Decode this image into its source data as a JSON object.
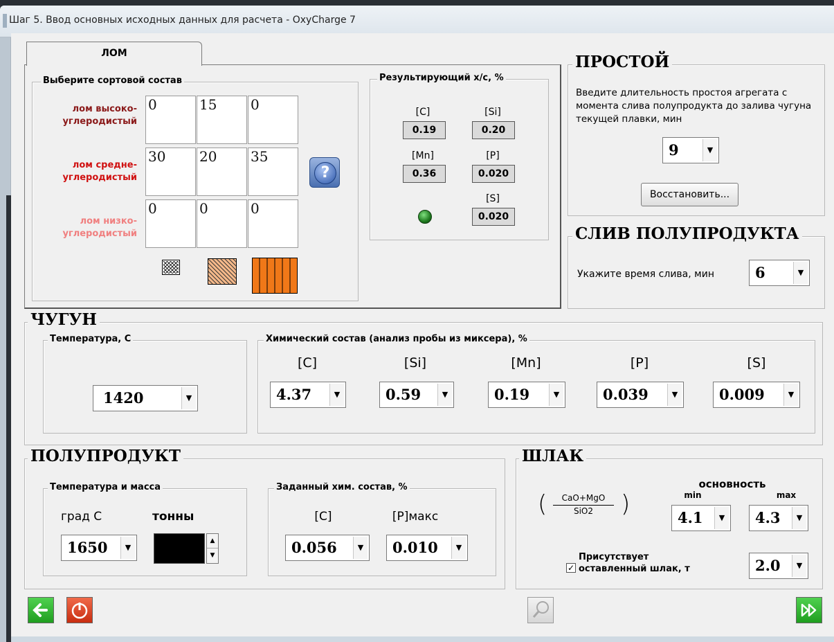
{
  "window": {
    "title": "Шаг 5. Ввод основных исходных данных для расчета - OxyCharge 7"
  },
  "scrap": {
    "tab_label": "ЛОМ",
    "sort_title": "Выберите сортовой состав",
    "rows": [
      {
        "label": "лом высоко-углеродистый",
        "values": [
          "0",
          "15",
          "0"
        ],
        "color": "#8b1a1a"
      },
      {
        "label": "лом средне-углеродистый",
        "values": [
          "30",
          "20",
          "35"
        ],
        "color": "#d01010"
      },
      {
        "label": "лом низко-углеродистый",
        "values": [
          "0",
          "0",
          "0"
        ],
        "color": "#f08080"
      }
    ],
    "help_label": "?",
    "result": {
      "title": "Результирующий х/с, %",
      "c_label": "[C]",
      "c_value": "0.19",
      "si_label": "[Si]",
      "si_value": "0.20",
      "mn_label": "[Mn]",
      "mn_value": "0.36",
      "p_label": "[P]",
      "p_value": "0.020",
      "s_label": "[S]",
      "s_value": "0.020",
      "status_color": "#1f7a1f"
    }
  },
  "idle": {
    "title": "ПРОСТОЙ",
    "description": "Введите длительность простоя агрегата с момента слива полупродукта до залива чугуна текущей плавки, мин",
    "value": "9",
    "restore_label": "Восстановить..."
  },
  "drain": {
    "title": "СЛИВ ПОЛУПРОДУКТА",
    "label": "Укажите время слива, мин",
    "value": "6"
  },
  "iron": {
    "title": "ЧУГУН",
    "temp_title": "Температура, С",
    "temp_value": "1420",
    "chem_title": "Химический состав (анализ пробы из миксера), %",
    "c_label": "[C]",
    "c_value": "4.37",
    "si_label": "[Si]",
    "si_value": "0.59",
    "mn_label": "[Mn]",
    "mn_value": "0.19",
    "p_label": "[P]",
    "p_value": "0.039",
    "s_label": "[S]",
    "s_value": "0.009"
  },
  "semi": {
    "title": "ПОЛУПРОДУКТ",
    "tm_title": "Температура и масса",
    "deg_label": "град С",
    "tons_label": "тонны",
    "temp_value": "1650",
    "target_title": "Заданный хим. состав, %",
    "c_label": "[C]",
    "c_value": "0.056",
    "p_label": "[P]макс",
    "p_value": "0.010"
  },
  "slag": {
    "title": "ШЛАК",
    "formula_num": "CaO+MgO",
    "formula_den": "SiO2",
    "basicity_label": "основность",
    "min_label": "min",
    "min_value": "4.1",
    "max_label": "max",
    "max_value": "4.3",
    "remaining_label_line1": "Присутствует",
    "remaining_label_line2": "оставленный шлак, т",
    "remaining_checked": "✓",
    "remaining_value": "2.0"
  },
  "colors": {
    "accent_orange": "#f07818",
    "green_button": "#2fb52f",
    "red_button": "#e03a1a"
  }
}
